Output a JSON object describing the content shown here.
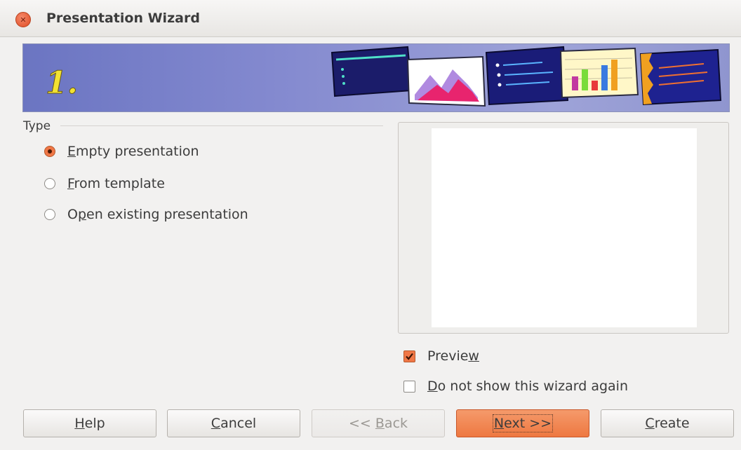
{
  "window": {
    "title": "Presentation Wizard"
  },
  "banner": {
    "step_number": "1."
  },
  "type_group": {
    "label": "Type",
    "options": [
      {
        "pre": "",
        "ul": "E",
        "post": "mpty presentation",
        "selected": true
      },
      {
        "pre": "",
        "ul": "F",
        "post": "rom template",
        "selected": false
      },
      {
        "pre": "O",
        "ul": "p",
        "post": "en existing presentation",
        "selected": false
      }
    ]
  },
  "preview_checkbox": {
    "pre": "Previe",
    "ul": "w",
    "post": "",
    "checked": true
  },
  "no_show_checkbox": {
    "pre": "",
    "ul": "D",
    "post": "o not show this wizard again",
    "checked": false
  },
  "buttons": {
    "help": {
      "pre": "",
      "ul": "H",
      "post": "elp"
    },
    "cancel": {
      "pre": "",
      "ul": "C",
      "post": "ancel"
    },
    "back": {
      "pre": "<< ",
      "ul": "B",
      "post": "ack",
      "enabled": false
    },
    "next": {
      "pre": "",
      "ul": "N",
      "post": "ext >>",
      "default": true
    },
    "create": {
      "pre": "",
      "ul": "C",
      "post": "reate"
    }
  },
  "colors": {
    "accent": "#f07746",
    "banner": "#8389cf"
  }
}
